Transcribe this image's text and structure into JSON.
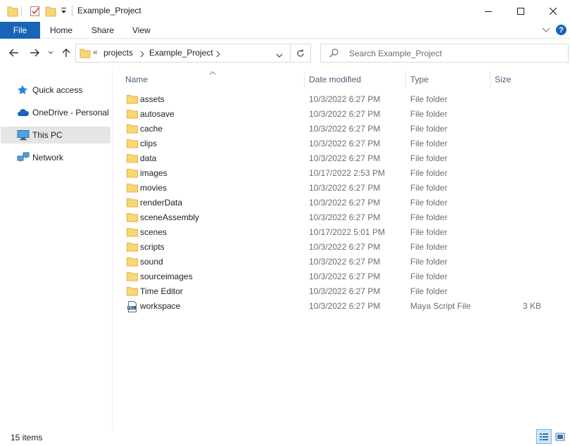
{
  "window": {
    "title": "Example_Project",
    "controls": {
      "minimize": "minimize",
      "maximize": "maximize",
      "close": "close"
    }
  },
  "ribbon": {
    "tabs": [
      "File",
      "Home",
      "Share",
      "View"
    ],
    "help": "?"
  },
  "address": {
    "overflow": "«",
    "crumbs": [
      "projects",
      "Example_Project"
    ]
  },
  "search": {
    "placeholder": "Search Example_Project"
  },
  "nav": {
    "items": [
      {
        "label": "Quick access",
        "icon": "star-icon"
      },
      {
        "label": "OneDrive - Personal",
        "icon": "cloud-icon"
      },
      {
        "label": "This PC",
        "icon": "computer-icon",
        "selected": true
      },
      {
        "label": "Network",
        "icon": "network-icon"
      }
    ]
  },
  "columns": {
    "name": "Name",
    "date": "Date modified",
    "type": "Type",
    "size": "Size"
  },
  "files": [
    {
      "name": "assets",
      "date": "10/3/2022 6:27 PM",
      "type": "File folder",
      "size": "",
      "icon": "folder-icon"
    },
    {
      "name": "autosave",
      "date": "10/3/2022 6:27 PM",
      "type": "File folder",
      "size": "",
      "icon": "folder-icon"
    },
    {
      "name": "cache",
      "date": "10/3/2022 6:27 PM",
      "type": "File folder",
      "size": "",
      "icon": "folder-icon"
    },
    {
      "name": "clips",
      "date": "10/3/2022 6:27 PM",
      "type": "File folder",
      "size": "",
      "icon": "folder-icon"
    },
    {
      "name": "data",
      "date": "10/3/2022 6:27 PM",
      "type": "File folder",
      "size": "",
      "icon": "folder-icon"
    },
    {
      "name": "images",
      "date": "10/17/2022 2:53 PM",
      "type": "File folder",
      "size": "",
      "icon": "folder-icon"
    },
    {
      "name": "movies",
      "date": "10/3/2022 6:27 PM",
      "type": "File folder",
      "size": "",
      "icon": "folder-icon"
    },
    {
      "name": "renderData",
      "date": "10/3/2022 6:27 PM",
      "type": "File folder",
      "size": "",
      "icon": "folder-icon"
    },
    {
      "name": "sceneAssembly",
      "date": "10/3/2022 6:27 PM",
      "type": "File folder",
      "size": "",
      "icon": "folder-icon"
    },
    {
      "name": "scenes",
      "date": "10/17/2022 5:01 PM",
      "type": "File folder",
      "size": "",
      "icon": "folder-icon"
    },
    {
      "name": "scripts",
      "date": "10/3/2022 6:27 PM",
      "type": "File folder",
      "size": "",
      "icon": "folder-icon"
    },
    {
      "name": "sound",
      "date": "10/3/2022 6:27 PM",
      "type": "File folder",
      "size": "",
      "icon": "folder-icon"
    },
    {
      "name": "sourceimages",
      "date": "10/3/2022 6:27 PM",
      "type": "File folder",
      "size": "",
      "icon": "folder-icon"
    },
    {
      "name": "Time Editor",
      "date": "10/3/2022 6:27 PM",
      "type": "File folder",
      "size": "",
      "icon": "folder-icon"
    },
    {
      "name": "workspace",
      "date": "10/3/2022 6:27 PM",
      "type": "Maya Script File",
      "size": "3 KB",
      "icon": "mel-file-icon"
    }
  ],
  "status": {
    "count": "15 items"
  },
  "colors": {
    "accent": "#1a64b8",
    "folder": "#f8d775",
    "folderDark": "#e8b83d",
    "selection": "#e5e5e5"
  }
}
